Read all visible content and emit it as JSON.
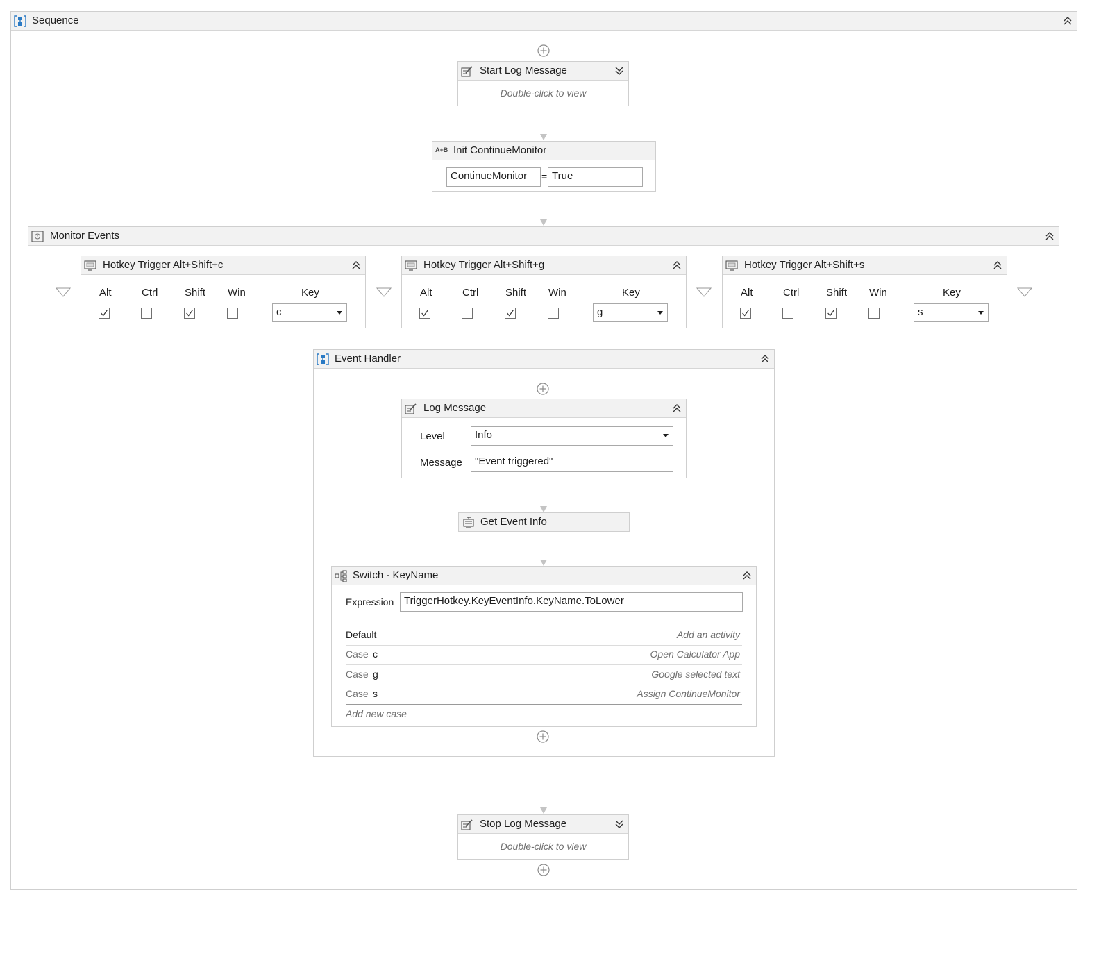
{
  "sequence": {
    "title": "Sequence"
  },
  "start_log": {
    "title": "Start Log Message",
    "hint": "Double-click to view"
  },
  "init_assign": {
    "title": "Init ContinueMonitor",
    "to": "ContinueMonitor",
    "equals": "=",
    "value": "True",
    "icon_text": "A+B"
  },
  "monitor": {
    "title": "Monitor Events",
    "triggers": [
      {
        "title": "Hotkey Trigger Alt+Shift+c",
        "headers": [
          "Alt",
          "Ctrl",
          "Shift",
          "Win",
          "Key"
        ],
        "alt": true,
        "ctrl": false,
        "shift": true,
        "win": false,
        "key": "c"
      },
      {
        "title": "Hotkey Trigger Alt+Shift+g",
        "headers": [
          "Alt",
          "Ctrl",
          "Shift",
          "Win",
          "Key"
        ],
        "alt": true,
        "ctrl": false,
        "shift": true,
        "win": false,
        "key": "g"
      },
      {
        "title": "Hotkey Trigger Alt+Shift+s",
        "headers": [
          "Alt",
          "Ctrl",
          "Shift",
          "Win",
          "Key"
        ],
        "alt": true,
        "ctrl": false,
        "shift": true,
        "win": false,
        "key": "s"
      }
    ]
  },
  "handler": {
    "title": "Event Handler"
  },
  "log_message": {
    "title": "Log Message",
    "level_label": "Level",
    "level_value": "Info",
    "message_label": "Message",
    "message_value": "\"Event triggered\""
  },
  "get_event": {
    "title": "Get Event Info"
  },
  "switch": {
    "title": "Switch - KeyName",
    "expression_label": "Expression",
    "expression_value": "TriggerHotkey.KeyEventInfo.KeyName.ToLower",
    "default_label": "Default",
    "default_action": "Add an activity",
    "case_label": "Case",
    "cases": [
      {
        "value": "c",
        "action": "Open Calculator App"
      },
      {
        "value": "g",
        "action": "Google selected text"
      },
      {
        "value": "s",
        "action": "Assign ContinueMonitor"
      }
    ],
    "add_case": "Add new case"
  },
  "stop_log": {
    "title": "Stop Log Message",
    "hint": "Double-click to view"
  },
  "colors": {
    "accent": "#2a7ac4",
    "border": "#cfcfcf",
    "header_bg": "#f2f2f2",
    "hint": "#707070",
    "connector": "#c4c4c4"
  }
}
